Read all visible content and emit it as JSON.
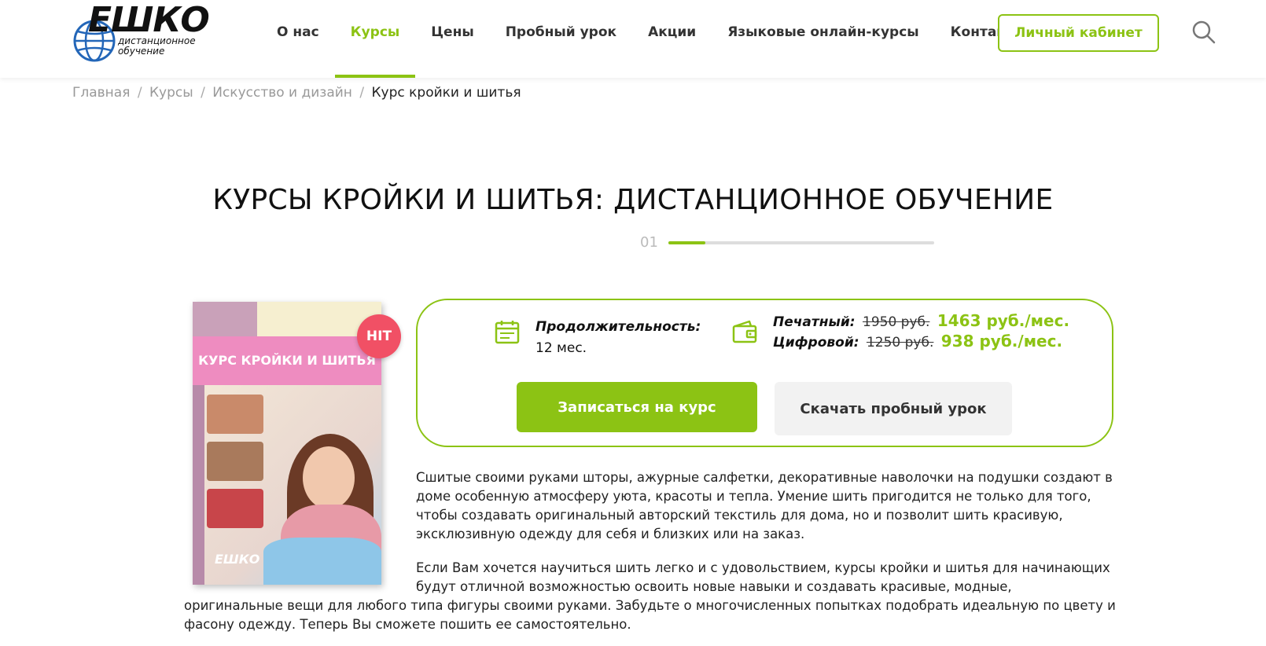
{
  "brand": {
    "name": "ЕШКО",
    "subtitle": "дистанционное обучение",
    "colors": {
      "accent": "#8cc314",
      "hit": "#f15065",
      "text": "#222222"
    }
  },
  "nav": {
    "items": [
      {
        "label": "О нас"
      },
      {
        "label": "Курсы"
      },
      {
        "label": "Цены"
      },
      {
        "label": "Пробный урок"
      },
      {
        "label": "Акции"
      },
      {
        "label": "Языковые онлайн-курсы"
      },
      {
        "label": "Контакты"
      }
    ],
    "active": "Курсы",
    "cabinet_label": "Личный кабинет",
    "search_icon": "search-icon"
  },
  "breadcrumb": {
    "items": [
      "Главная",
      "Курсы",
      "Искусство и дизайн"
    ],
    "separator": "/",
    "current": "Курс кройки и шитья"
  },
  "page": {
    "title": "КУРСЫ КРОЙКИ И ШИТЬЯ: ДИСТАНЦИОННОЕ ОБУЧЕНИЕ",
    "step": "01",
    "step_progress": 0.14
  },
  "book": {
    "cover_title": "КУРС КРОЙКИ И ШИТЬЯ",
    "logo": "ЕШКО",
    "badge": "HIT"
  },
  "course": {
    "duration_label": "Продолжительность:",
    "duration_value": "12 мес.",
    "printed_label": "Печатный:",
    "printed_old": "1950 руб.",
    "printed_new": "1463 руб./мес.",
    "digital_label": "Цифровой:",
    "digital_old": "1250 руб.",
    "digital_new": "938 руб./мес.",
    "enroll_label": "Записаться на курс",
    "trial_label": "Скачать пробный урок",
    "duration_icon": "calendar-icon",
    "price_icon": "wallet-icon"
  },
  "description": {
    "p1": "Сшитые своими руками шторы, ажурные салфетки, декоративные наволочки на подушки создают в доме особенную атмосферу уюта, красоты и тепла. Умение шить пригодится не только для того, чтобы создавать оригинальный авторский текстиль для дома, но и позволит шить красивую, эксклюзивную одежду для себя и близких или на заказ.",
    "p2_part1": "Если Вам хочется научиться шить легко и с удовольствием, курсы кройки и шитья для начинающих будут отличной возможностью освоить новые навыки и создавать красивые, модные,",
    "p2_part2": "оригинальные вещи для любого типа фигуры своими руками. Забудьте о многочисленных попытках подобрать идеальную по цвету и фасону одежду. Теперь Вы сможете пошить ее самостоятельно."
  }
}
